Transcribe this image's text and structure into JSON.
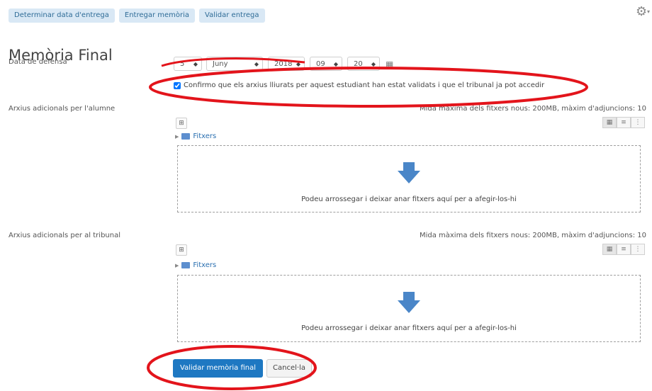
{
  "tabs": [
    "Determinar data d'entrega",
    "Entregar memòria",
    "Validar entrega"
  ],
  "title": "Memòria Final",
  "defense": {
    "label": "Data de defensa",
    "selects": {
      "day": "5",
      "month": "Juny",
      "year": "2018",
      "hour": "09",
      "minute": "20"
    },
    "confirm_text": "Confirmo que els arxius lliurats per aquest estudiant han estat validats i que el tribunal ja pot accedir",
    "confirm_checked": true
  },
  "student_files": {
    "label": "Arxius adicionals per l'alumne",
    "meta": "Mida màxima dels fitxers nous: 200MB, màxim d'adjuncions: 10",
    "folder": "Fitxers",
    "drop_text": "Podeu arrossegar i deixar anar fitxers aquí per a afegir-los-hi"
  },
  "tribunal_files": {
    "label": "Arxius adicionals per al tribunal",
    "meta": "Mida màxima dels fitxers nous: 200MB, màxim d'adjuncions: 10",
    "folder": "Fitxers",
    "drop_text": "Podeu arrossegar i deixar anar fitxers aquí per a afegir-los-hi"
  },
  "buttons": {
    "submit": "Validar memòria final",
    "cancel": "Cancel·la"
  },
  "colors": {
    "annotation": "#e3141b",
    "primary": "#1e78c2",
    "tab_bg": "#d9e8f5",
    "link": "#2a6fb0"
  },
  "icons": [
    "gear-icon",
    "calendar-icon",
    "add-file-icon",
    "folder-icon",
    "drop-arrow-icon",
    "grid-view-icon",
    "list-view-icon",
    "tree-view-icon"
  ]
}
